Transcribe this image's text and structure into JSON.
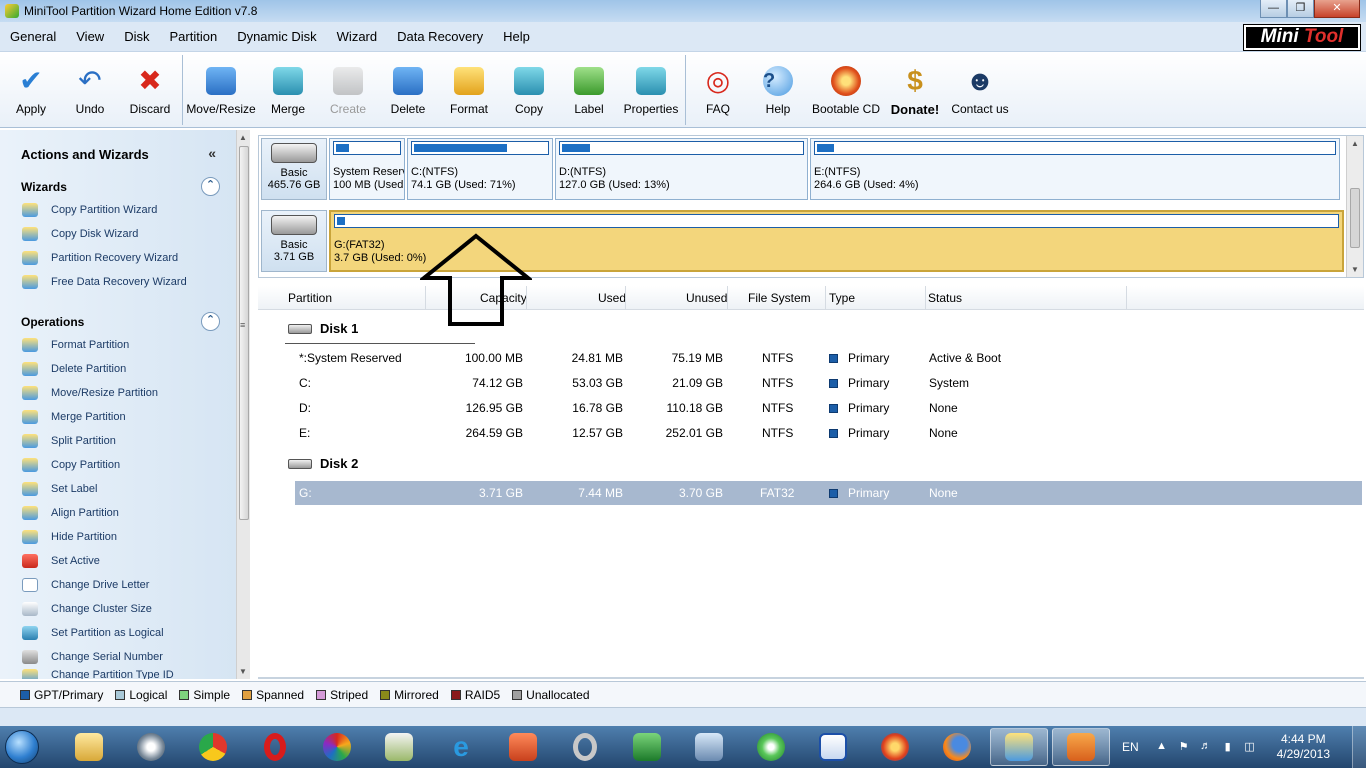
{
  "window": {
    "title": "MiniTool Partition Wizard Home Edition v7.8"
  },
  "menu": [
    "General",
    "View",
    "Disk",
    "Partition",
    "Dynamic Disk",
    "Wizard",
    "Data Recovery",
    "Help"
  ],
  "logo": {
    "part1": "Mini",
    "part2": "Tool"
  },
  "toolbar": {
    "apply": "Apply",
    "undo": "Undo",
    "discard": "Discard",
    "move_resize": "Move/Resize",
    "merge": "Merge",
    "create": "Create",
    "delete": "Delete",
    "format": "Format",
    "copy": "Copy",
    "label": "Label",
    "properties": "Properties",
    "faq": "FAQ",
    "help": "Help",
    "bootable_cd": "Bootable CD",
    "donate": "Donate!",
    "contact_us": "Contact us"
  },
  "sidebar": {
    "title": "Actions and Wizards",
    "wizards_title": "Wizards",
    "wizards": [
      "Copy Partition Wizard",
      "Copy Disk Wizard",
      "Partition Recovery Wizard",
      "Free Data Recovery Wizard"
    ],
    "operations_title": "Operations",
    "operations": [
      "Format Partition",
      "Delete Partition",
      "Move/Resize Partition",
      "Merge Partition",
      "Split Partition",
      "Copy Partition",
      "Set Label",
      "Align Partition",
      "Hide Partition",
      "Set Active",
      "Change Drive Letter",
      "Change Cluster Size",
      "Set Partition as Logical",
      "Change Serial Number",
      "Change Partition Type ID"
    ]
  },
  "diskmap": {
    "disk1": {
      "type": "Basic",
      "size": "465.76 GB",
      "partitions": [
        {
          "name": "System Reserv",
          "info": "100 MB (Used:",
          "used_fraction": 0.25
        },
        {
          "name": "C:(NTFS)",
          "info": "74.1 GB (Used: 71%)",
          "used_fraction": 0.71
        },
        {
          "name": "D:(NTFS)",
          "info": "127.0 GB (Used: 13%)",
          "used_fraction": 0.13
        },
        {
          "name": "E:(NTFS)",
          "info": "264.6 GB (Used: 4%)",
          "used_fraction": 0.04
        }
      ]
    },
    "disk2": {
      "type": "Basic",
      "size": "3.71 GB",
      "partitions": [
        {
          "name": "G:(FAT32)",
          "info": "3.7 GB (Used: 0%)",
          "used_fraction": 0.0
        }
      ]
    }
  },
  "table": {
    "headers": {
      "partition": "Partition",
      "capacity": "Capacity",
      "used": "Used",
      "unused": "Unused",
      "file_system": "File System",
      "type": "Type",
      "status": "Status"
    },
    "disk1_label": "Disk 1",
    "disk2_label": "Disk 2",
    "disk1_rows": [
      {
        "partition": "*:System Reserved",
        "capacity": "100.00 MB",
        "used": "24.81 MB",
        "unused": "75.19 MB",
        "fs": "NTFS",
        "type": "Primary",
        "status": "Active & Boot"
      },
      {
        "partition": "C:",
        "capacity": "74.12 GB",
        "used": "53.03 GB",
        "unused": "21.09 GB",
        "fs": "NTFS",
        "type": "Primary",
        "status": "System"
      },
      {
        "partition": "D:",
        "capacity": "126.95 GB",
        "used": "16.78 GB",
        "unused": "110.18 GB",
        "fs": "NTFS",
        "type": "Primary",
        "status": "None"
      },
      {
        "partition": "E:",
        "capacity": "264.59 GB",
        "used": "12.57 GB",
        "unused": "252.01 GB",
        "fs": "NTFS",
        "type": "Primary",
        "status": "None"
      }
    ],
    "disk2_rows": [
      {
        "partition": "G:",
        "capacity": "3.71 GB",
        "used": "7.44 MB",
        "unused": "3.70 GB",
        "fs": "FAT32",
        "type": "Primary",
        "status": "None"
      }
    ]
  },
  "legend": [
    {
      "label": "GPT/Primary",
      "color": "#1c5ea8"
    },
    {
      "label": "Logical",
      "color": "#a8c8d8"
    },
    {
      "label": "Simple",
      "color": "#7ed47e"
    },
    {
      "label": "Spanned",
      "color": "#e0a040"
    },
    {
      "label": "Striped",
      "color": "#d49ad8"
    },
    {
      "label": "Mirrored",
      "color": "#8a8a1a"
    },
    {
      "label": "RAID5",
      "color": "#8a1a1a"
    },
    {
      "label": "Unallocated",
      "color": "#a0a0a0"
    }
  ],
  "taskbar": {
    "lang": "EN",
    "time": "4:44 PM",
    "date": "4/29/2013"
  }
}
